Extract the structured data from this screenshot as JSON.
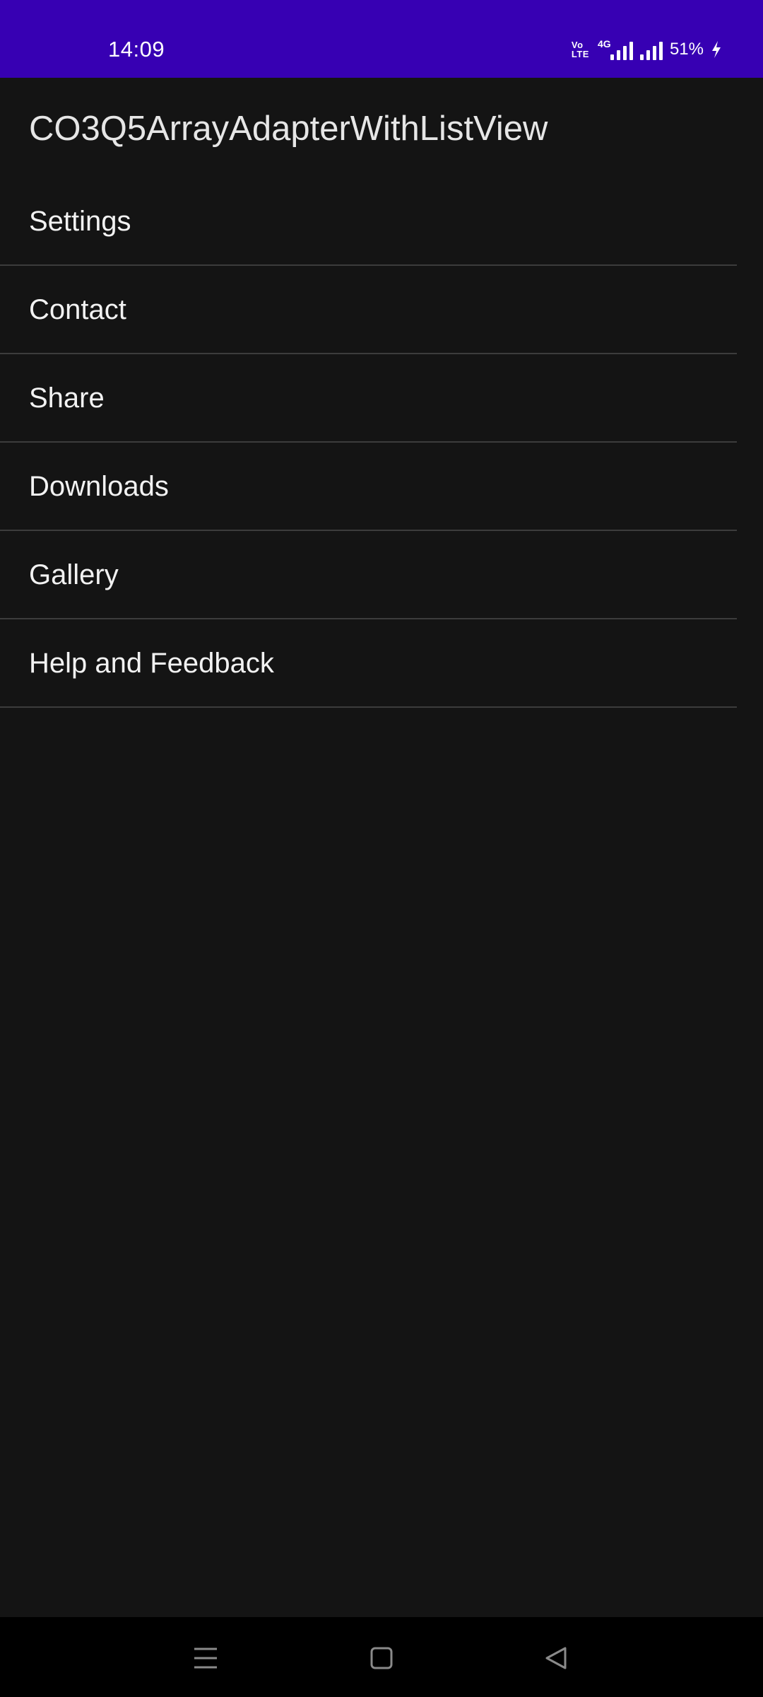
{
  "status_bar": {
    "time": "14:09",
    "volte_top": "Vo",
    "volte_bottom": "LTE",
    "network_type": "4G",
    "battery_percent": "51%",
    "icons": [
      "volte-icon",
      "mobile-data-4g-icon",
      "signal-icon",
      "battery-charging-icon"
    ],
    "background": "#3700b3"
  },
  "app_bar": {
    "title": "CO3Q5ArrayAdapterWithListView"
  },
  "list": {
    "items": [
      {
        "label": "Settings"
      },
      {
        "label": "Contact"
      },
      {
        "label": "Share"
      },
      {
        "label": "Downloads"
      },
      {
        "label": "Gallery"
      },
      {
        "label": "Help and Feedback"
      }
    ]
  },
  "nav_bar": {
    "buttons": [
      "menu-icon",
      "home-icon",
      "back-icon"
    ]
  },
  "colors": {
    "background": "#141414",
    "divider": "#3c3c3c",
    "text": "#f2f2f2"
  }
}
